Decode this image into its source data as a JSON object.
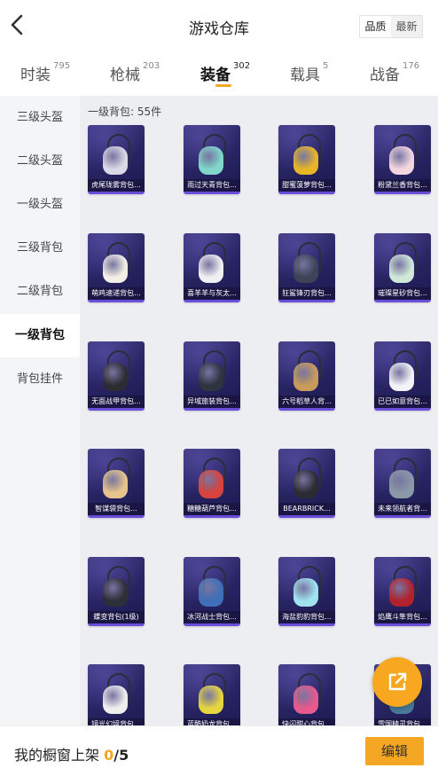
{
  "header": {
    "title": "游戏仓库",
    "sort_options": [
      "品质",
      "最新"
    ],
    "sort_active": 0
  },
  "tabs": [
    {
      "label": "时装",
      "count": "795"
    },
    {
      "label": "枪械",
      "count": "203"
    },
    {
      "label": "装备",
      "count": "302",
      "active": true
    },
    {
      "label": "载具",
      "count": "5"
    },
    {
      "label": "战备",
      "count": "176"
    }
  ],
  "sidebar": {
    "items": [
      {
        "label": "三级头盔"
      },
      {
        "label": "二级头盔"
      },
      {
        "label": "一级头盔"
      },
      {
        "label": "三级背包"
      },
      {
        "label": "二级背包"
      },
      {
        "label": "一级背包",
        "active": true
      },
      {
        "label": "背包挂件"
      }
    ]
  },
  "section": {
    "title": "一级背包: 55件"
  },
  "items": [
    {
      "name": "虎尾珑雾背包...",
      "icon": "backpack-icon",
      "color": "#d8d8e6"
    },
    {
      "name": "雨过天青背包...",
      "icon": "backpack-icon",
      "color": "#7fd6c9"
    },
    {
      "name": "甜蜜菠萝背包...",
      "icon": "backpack-icon",
      "color": "#e8b526"
    },
    {
      "name": "粉黛兰香背包...",
      "icon": "backpack-icon",
      "color": "#f1d6e0"
    },
    {
      "name": "萌鸡速递背包...",
      "icon": "backpack-icon",
      "color": "#f3efe6"
    },
    {
      "name": "喜羊羊与灰太...",
      "icon": "backpack-icon",
      "color": "#f0f0f4"
    },
    {
      "name": "狂鲨锋刃背包...",
      "icon": "backpack-icon",
      "color": "#3d4457"
    },
    {
      "name": "璀璨星砂背包...",
      "icon": "backpack-icon",
      "color": "#cfe8d8"
    },
    {
      "name": "无面战甲背包...",
      "icon": "backpack-icon",
      "color": "#2c2d33"
    },
    {
      "name": "异域旅装背包...",
      "icon": "backpack-icon",
      "color": "#2e3440"
    },
    {
      "name": "六号稻草人背...",
      "icon": "backpack-icon",
      "color": "#c89b5a"
    },
    {
      "name": "已已如意背包...",
      "icon": "backpack-icon",
      "color": "#f1f3f7"
    },
    {
      "name": "智谋袋背包...",
      "icon": "backpack-icon",
      "color": "#e6c48c"
    },
    {
      "name": "糖糖葫芦背包...",
      "icon": "backpack-icon",
      "color": "#d8433d"
    },
    {
      "name": "BEARBRICK...",
      "icon": "backpack-icon",
      "color": "#2b2b33"
    },
    {
      "name": "未来领航者背...",
      "icon": "backpack-icon",
      "color": "#8a98a8"
    },
    {
      "name": "蝶变背包(1级)",
      "icon": "backpack-icon",
      "color": "#2d2f38"
    },
    {
      "name": "冰河战士背包...",
      "icon": "backpack-icon",
      "color": "#3e6fb8"
    },
    {
      "name": "海盐豹豹背包...",
      "icon": "backpack-icon",
      "color": "#9fe3f0"
    },
    {
      "name": "焰鹰斗隼背包...",
      "icon": "backpack-icon",
      "color": "#b2222d"
    },
    {
      "name": "镜光幻境背包...",
      "icon": "backpack-icon",
      "color": "#eeeeef"
    },
    {
      "name": "蓝酷奶龙背包...",
      "icon": "backpack-icon",
      "color": "#e5d640"
    },
    {
      "name": "快闪甜心背包...",
      "icon": "backpack-icon",
      "color": "#e65a8c"
    },
    {
      "name": "雪国精灵背包...",
      "icon": "backpack-icon",
      "color": "#4a7a9a"
    }
  ],
  "bottom": {
    "label": "我的橱窗上架 ",
    "current": "0",
    "max": "/5",
    "edit": "编辑"
  },
  "colors": {
    "accent": "#f5a623",
    "card": "#2a2666"
  }
}
